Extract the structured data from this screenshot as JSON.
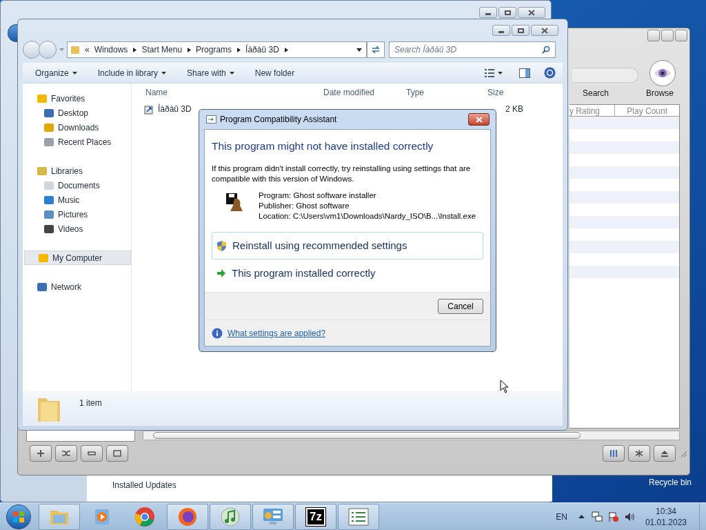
{
  "back_window": {
    "status_text": "Installed Updates"
  },
  "desktop": {
    "icons": [
      {
        "label": "Recycle bin"
      }
    ]
  },
  "media_player": {
    "buttons": [
      "Search",
      "Browse"
    ],
    "columns": [
      "y Rating",
      "Play Count"
    ]
  },
  "explorer": {
    "breadcrumb": [
      "«",
      "Windows",
      "Start Menu",
      "Programs",
      "Íàðàû 3D"
    ],
    "search": {
      "placeholder": "Search Íàðàû 3D"
    },
    "toolbar": [
      {
        "label": "Organize",
        "dropdown": true
      },
      {
        "label": "Include in library",
        "dropdown": true
      },
      {
        "label": "Share with",
        "dropdown": true
      },
      {
        "label": "New folder",
        "dropdown": false
      }
    ],
    "nav": [
      {
        "label": "Favorites",
        "selected": false,
        "children": [
          {
            "label": "Desktop",
            "selected": false
          },
          {
            "label": "Downloads",
            "selected": false
          },
          {
            "label": "Recent Places",
            "selected": false
          }
        ]
      },
      {
        "label": "Libraries",
        "selected": false,
        "children": [
          {
            "label": "Documents",
            "selected": false
          },
          {
            "label": "Music",
            "selected": false
          },
          {
            "label": "Pictures",
            "selected": false
          },
          {
            "label": "Videos",
            "selected": false
          }
        ]
      },
      {
        "label": "My Computer",
        "selected": true
      },
      {
        "label": "Network",
        "selected": false
      }
    ],
    "columns": [
      "Name",
      "Date modified",
      "Type",
      "Size"
    ],
    "files": [
      {
        "name": "Íàðàû 3D",
        "size": "2 KB"
      }
    ],
    "status": "1 item"
  },
  "dialog": {
    "title": "Program Compatibility Assistant",
    "heading": "This program might not have installed correctly",
    "message": "If this program didn't install correctly, try reinstalling using settings that are compatible with this version of Windows.",
    "details": [
      "Program: Ghost software installer",
      "Publisher: Ghost software",
      "Location: C:\\Users\\vm1\\Downloads\\Nardy_ISO\\B...\\Install.exe"
    ],
    "options": [
      {
        "label": "Reinstall using recommended settings",
        "selected": true
      },
      {
        "label": "This program installed correctly",
        "selected": false
      }
    ],
    "buttons": [
      "Cancel"
    ],
    "help_link": "What settings are applied?"
  },
  "taskbar": {
    "apps": [
      {
        "running": true
      },
      {
        "running": false
      },
      {
        "running": false
      },
      {
        "running": true
      },
      {
        "running": true
      },
      {
        "running": true
      },
      {
        "running": true,
        "label": "7z"
      },
      {
        "running": true
      }
    ],
    "language": "EN",
    "time": "10:34",
    "date": "01.01.2023"
  }
}
